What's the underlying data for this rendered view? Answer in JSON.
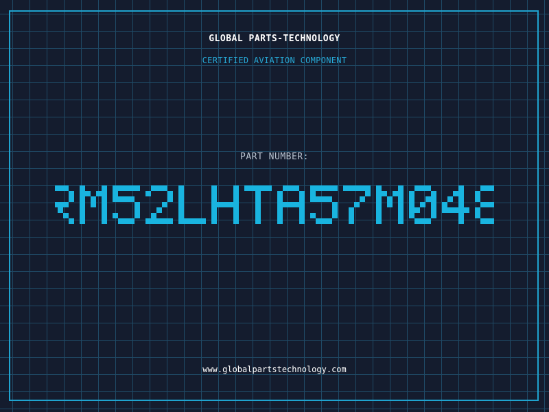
{
  "label": {
    "brand": "GLOBAL PARTS-TECHNOLOGY",
    "tagline": "CERTIFIED AVIATION COMPONENT",
    "part_label": "PART NUMBER:",
    "part_number": "RM52LHTA57M048",
    "website": "www.globalpartstechnology.com"
  },
  "colors": {
    "background": "#141c2e",
    "grid_line": "#1f4a66",
    "frame": "#1fa3cf",
    "accent": "#27a9d6",
    "part_number": "#19b4e0"
  }
}
